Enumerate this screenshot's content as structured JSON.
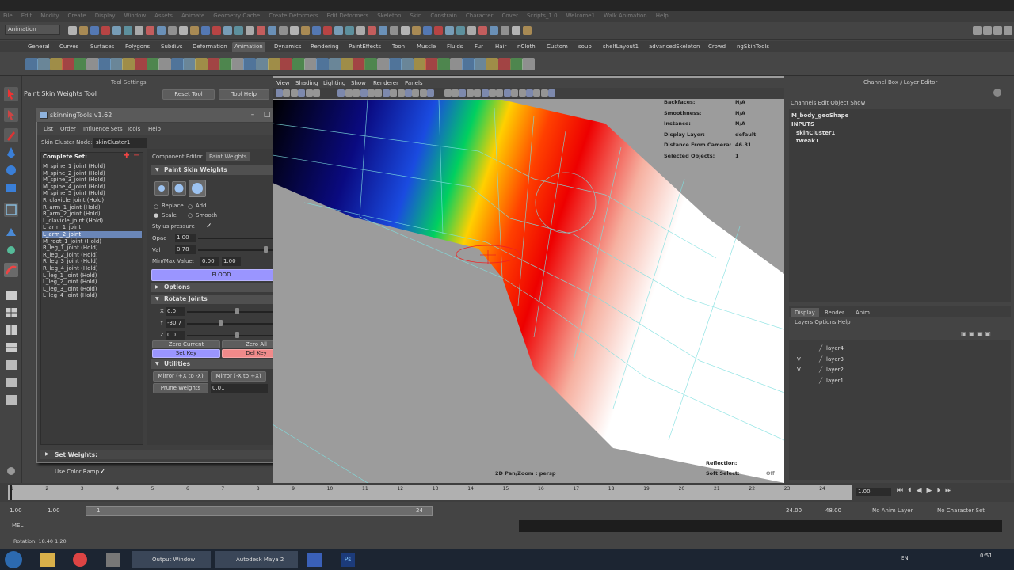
{
  "mode": "Animation",
  "menu_items": [
    "File",
    "Edit",
    "Modify",
    "Create",
    "Display",
    "Window",
    "Assets",
    "Animate",
    "Geometry Cache",
    "Create Deformers",
    "Edit Deformers",
    "Skeleton",
    "Skin",
    "Constrain",
    "Character",
    "Cover",
    "Scripts_1.0",
    "Welcome1",
    "Walk Animation",
    "Help"
  ],
  "shelf_tabs": [
    "General",
    "Curves",
    "Surfaces",
    "Polygons",
    "Subdivs",
    "Deformation",
    "Animation",
    "Dynamics",
    "Rendering",
    "PaintEffects",
    "Toon",
    "Muscle",
    "Fluids",
    "Fur",
    "Hair",
    "nCloth",
    "Custom",
    "soup",
    "shelfLayout1",
    "advancedSkeleton",
    "Crowd",
    "ngSkinTools"
  ],
  "shelf_active": "Animation",
  "tool_settings": {
    "title": "Tool Settings",
    "tool_name": "Paint Skin Weights Tool",
    "reset_label": "Reset Tool",
    "help_label": "Tool Help"
  },
  "skin_window": {
    "title": "skinningTools v1.62",
    "menu": [
      "List",
      "Order",
      "Influence Sets",
      "Tools",
      "Help"
    ],
    "skin_cluster_label": "Skin Cluster Node:",
    "skin_cluster_value": "skinCluster1",
    "complete_set": "Complete Set:",
    "joints": [
      "M_spine_1_joint (Hold)",
      "M_spine_2_joint (Hold)",
      "M_spine_3_joint (Hold)",
      "M_spine_4_joint (Hold)",
      "M_spine_5_joint (Hold)",
      "R_clavicle_joint (Hold)",
      "R_arm_1_joint (Hold)",
      "R_arm_2_joint (Hold)",
      "L_clavicle_joint (Hold)",
      "L_arm_1_joint",
      "L_arm_2_joint",
      "M_root_1_joint (Hold)",
      "R_leg_1_joint (Hold)",
      "R_leg_2_joint (Hold)",
      "R_leg_3_joint (Hold)",
      "R_leg_4_joint (Hold)",
      "L_leg_1_joint (Hold)",
      "L_leg_2_joint (Hold)",
      "L_leg_3_joint (Hold)",
      "L_leg_4_joint (Hold)"
    ],
    "selected_joint_index": 10,
    "tabs": [
      "Component Editor",
      "Paint Weights"
    ],
    "paint_section": "Paint Skin Weights",
    "replace": "Replace",
    "add": "Add",
    "scale": "Scale",
    "smooth": "Smooth",
    "stylus": "Stylus pressure",
    "stylus_check": "✓",
    "opac_label": "Opac",
    "opac_value": "1.00",
    "val_label": "Val",
    "val_value": "0.78",
    "minmax_label": "Min/Max Value:",
    "min_value": "0.00",
    "max_value": "1.00",
    "flood": "FLOOD",
    "options_section": "Options",
    "rotate_section": "Rotate Joints",
    "x_label": "X",
    "x_value": "0.0",
    "y_label": "Y",
    "y_value": "-30.7",
    "z_label": "Z",
    "z_value": "0.0",
    "zero_current": "Zero Current",
    "zero_all": "Zero All",
    "set_key": "Set Key",
    "del_key": "Del Key",
    "utilities_section": "Utilities",
    "mirror_pos": "Mirror (+X to -X)",
    "mirror_neg": "Mirror (-X to +X)",
    "prune": "Prune Weights",
    "prune_value": "0.01",
    "set_weights": "Set Weights:"
  },
  "color_ramp": "Use Color Ramp",
  "color_ramp_check": "✓",
  "viewport": {
    "menu": [
      "View",
      "Shading",
      "Lighting",
      "Show",
      "Renderer",
      "Panels"
    ],
    "hud_labels": [
      "Backfaces:",
      "Smoothness:",
      "Instance:",
      "Display Layer:",
      "Distance From Camera:",
      "Selected Objects:"
    ],
    "hud_values": [
      "N/A",
      "N/A",
      "N/A",
      "default",
      "46.31",
      "1"
    ],
    "bottom_text": "2D Pan/Zoom : persp",
    "reflection": "Reflection:",
    "soft_select": "Soft Select:",
    "soft_select_value": "Off"
  },
  "channel_box": {
    "title": "Channel Box / Layer Editor",
    "menu": "Channels   Edit   Object   Show",
    "shape": "M_body_geoShape",
    "inputs": "INPUTS",
    "input1": "skinCluster1",
    "input2": "tweak1"
  },
  "layer_tabs": [
    "Display",
    "Render",
    "Anim"
  ],
  "layer_menu": "Layers   Options   Help",
  "layers": [
    {
      "name": "layer4",
      "v": ""
    },
    {
      "name": "layer3",
      "v": "V"
    },
    {
      "name": "layer2",
      "v": "V"
    },
    {
      "name": "layer1",
      "v": ""
    }
  ],
  "timeline": {
    "ticks": [
      "1",
      "2",
      "3",
      "4",
      "5",
      "6",
      "7",
      "8",
      "9",
      "10",
      "11",
      "12",
      "13",
      "14",
      "15",
      "16",
      "17",
      "18",
      "19",
      "20",
      "21",
      "22",
      "23",
      "24"
    ],
    "current": "1.00",
    "range_start": "1.00",
    "range_start2": "1.00",
    "range_mid": "1",
    "range_mid2": "24",
    "range_end": "24.00",
    "range_end2": "48.00",
    "anim_layer": "No Anim Layer",
    "char_set": "No Character Set"
  },
  "mel_label": "MEL",
  "help_line": "Rotation:    18.40    1.20",
  "taskbar": {
    "items": [
      "Output Window",
      "Autodesk Maya 2"
    ],
    "lang": "EN",
    "time": "0:51"
  },
  "colors": {
    "selection": "#6a86b7",
    "flood": "#9a95ff",
    "setkey": "#9a95ff",
    "delkey": "#f08a8a"
  }
}
